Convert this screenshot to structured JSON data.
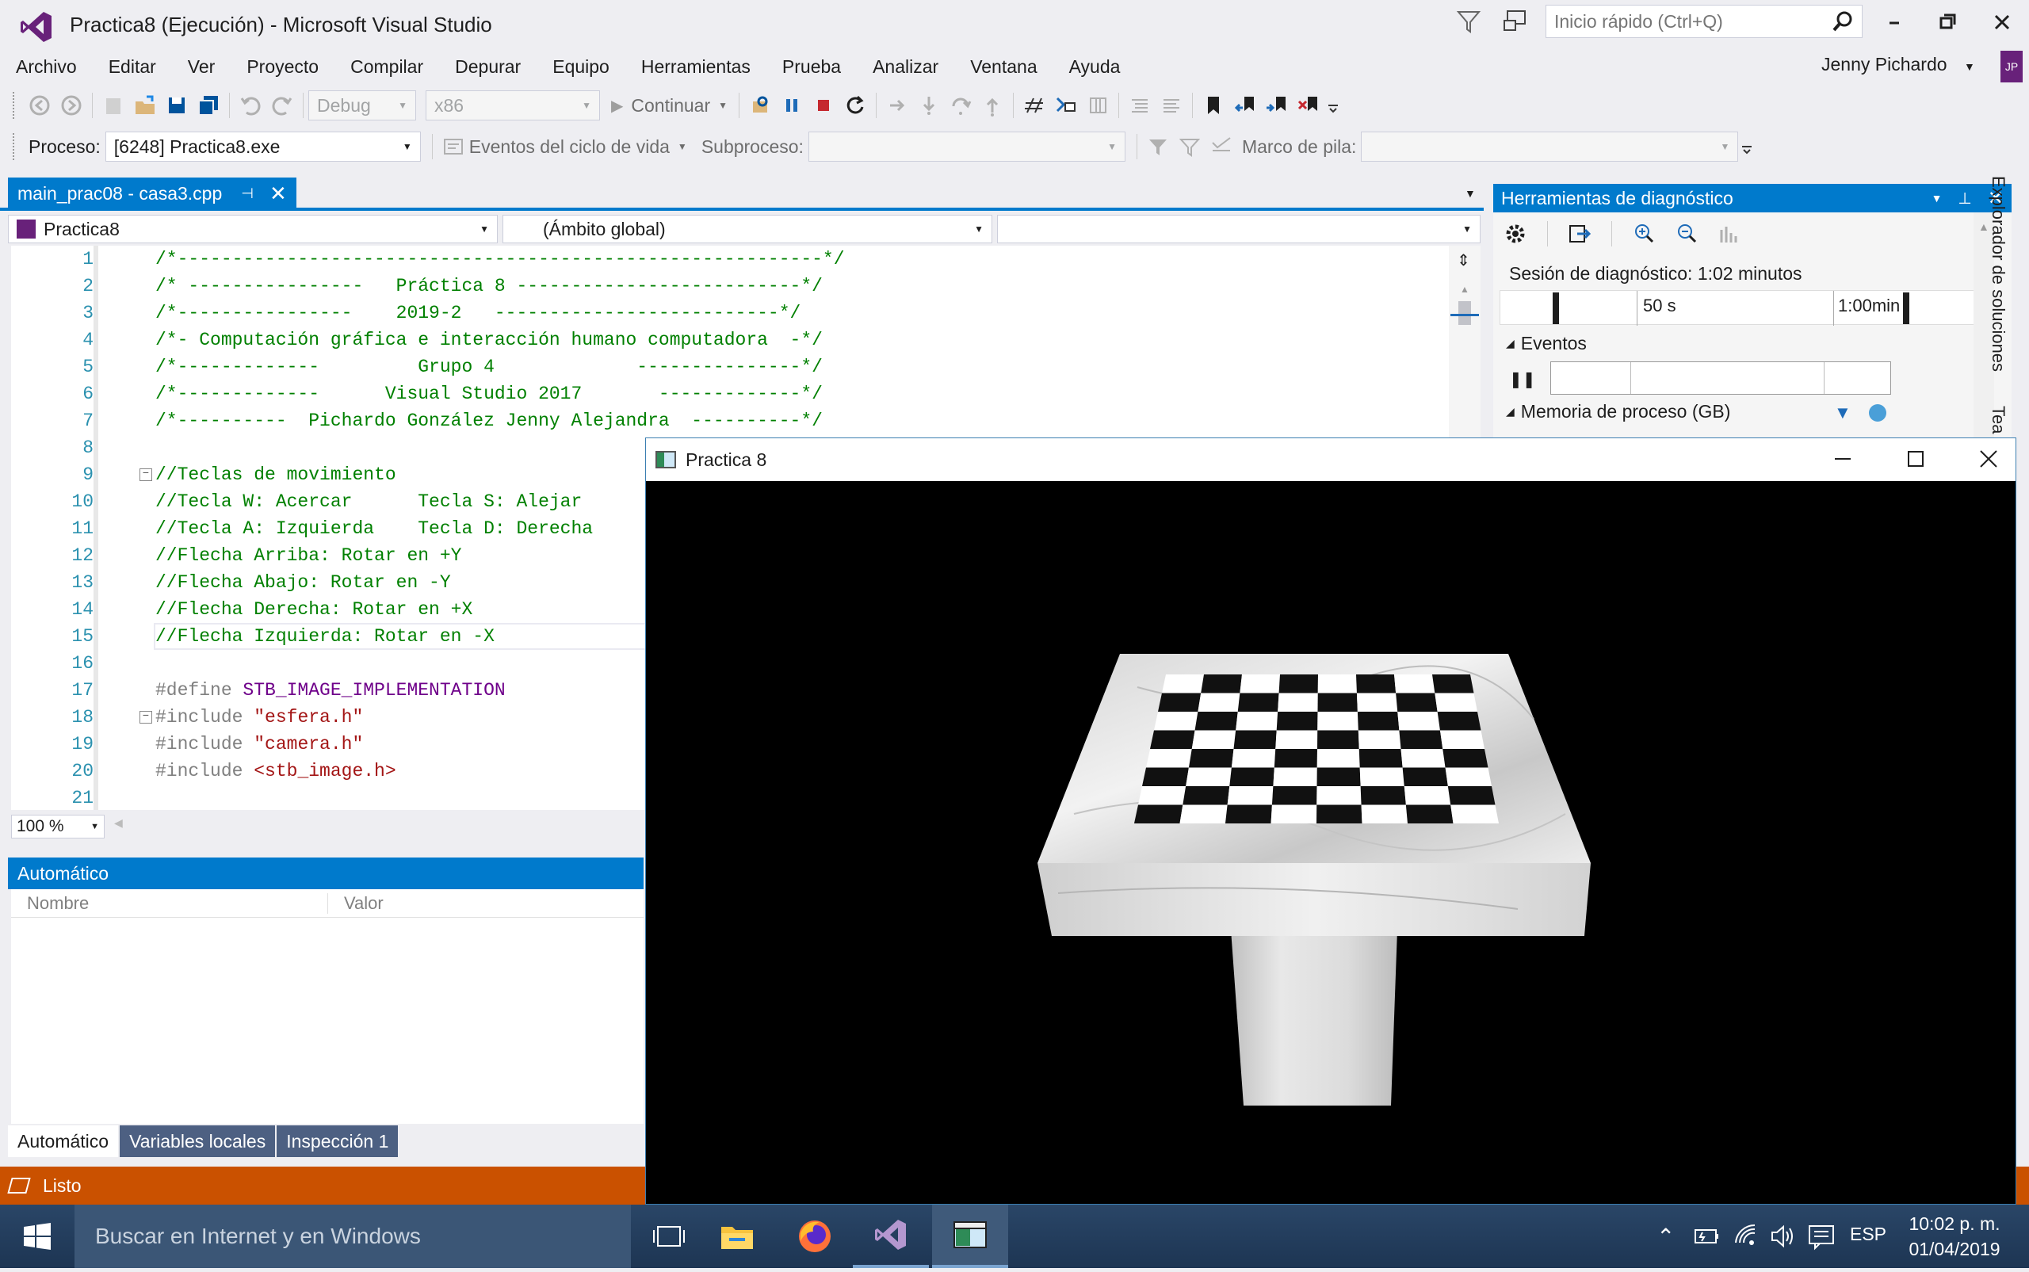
{
  "window": {
    "title": "Practica8 (Ejecución) - Microsoft Visual Studio",
    "quick_launch_placeholder": "Inicio rápido (Ctrl+Q)",
    "user": "Jenny Pichardo",
    "user_initials": "JP"
  },
  "menu": [
    "Archivo",
    "Editar",
    "Ver",
    "Proyecto",
    "Compilar",
    "Depurar",
    "Equipo",
    "Herramientas",
    "Prueba",
    "Analizar",
    "Ventana",
    "Ayuda"
  ],
  "toolbar": {
    "config": "Debug",
    "platform": "x86",
    "continue_label": "Continuar"
  },
  "debug_bar": {
    "process_label": "Proceso:",
    "process_value": "[6248] Practica8.exe",
    "lifecycle_label": "Eventos del ciclo de vida",
    "thread_label": "Subproceso:",
    "stack_label": "Marco de pila:"
  },
  "editor": {
    "tab_label": "main_prac08 - casa3.cpp",
    "project_combo": "Practica8",
    "scope_combo": "(Ámbito global)",
    "zoom": "100 %",
    "lines": [
      {
        "n": "1",
        "segments": [
          {
            "t": "/*-----------------------------------------------------------*/",
            "c": "cmt"
          }
        ]
      },
      {
        "n": "2",
        "segments": [
          {
            "t": "/* ----------------   Práctica 8 --------------------------*/",
            "c": "cmt"
          }
        ]
      },
      {
        "n": "3",
        "segments": [
          {
            "t": "/*----------------    2019-2   --------------------------*/",
            "c": "cmt"
          }
        ]
      },
      {
        "n": "4",
        "segments": [
          {
            "t": "/*- Computación gráfica e interacción humano computadora  -*/",
            "c": "cmt"
          }
        ]
      },
      {
        "n": "5",
        "segments": [
          {
            "t": "/*-------------         Grupo 4             ---------------*/",
            "c": "cmt"
          }
        ]
      },
      {
        "n": "6",
        "segments": [
          {
            "t": "/*-------------      Visual Studio 2017       -------------*/",
            "c": "cmt"
          }
        ]
      },
      {
        "n": "7",
        "segments": [
          {
            "t": "/*----------  Pichardo González Jenny Alejandra  ----------*/",
            "c": "cmt"
          }
        ]
      },
      {
        "n": "8",
        "segments": []
      },
      {
        "n": "9",
        "segments": [
          {
            "t": "//Teclas de movimiento",
            "c": "cmt"
          }
        ],
        "fold": true
      },
      {
        "n": "10",
        "segments": [
          {
            "t": "//Tecla W: Acercar      Tecla S: Alejar",
            "c": "cmt"
          }
        ]
      },
      {
        "n": "11",
        "segments": [
          {
            "t": "//Tecla A: Izquierda    Tecla D: Derecha",
            "c": "cmt"
          }
        ]
      },
      {
        "n": "12",
        "segments": [
          {
            "t": "//Flecha Arriba: Rotar en +Y",
            "c": "cmt"
          }
        ]
      },
      {
        "n": "13",
        "segments": [
          {
            "t": "//Flecha Abajo: Rotar en -Y",
            "c": "cmt"
          }
        ]
      },
      {
        "n": "14",
        "segments": [
          {
            "t": "//Flecha Derecha: Rotar en +X",
            "c": "cmt"
          }
        ]
      },
      {
        "n": "15",
        "segments": [
          {
            "t": "//Flecha Izquierda: Rotar en -X",
            "c": "cmt"
          }
        ]
      },
      {
        "n": "16",
        "segments": []
      },
      {
        "n": "17",
        "segments": [
          {
            "t": "#define ",
            "c": "prep"
          },
          {
            "t": "STB_IMAGE_IMPLEMENTATION",
            "c": "macro"
          }
        ]
      },
      {
        "n": "18",
        "segments": [
          {
            "t": "#include ",
            "c": "prep"
          },
          {
            "t": "\"esfera.h\"",
            "c": "str"
          }
        ],
        "fold": true
      },
      {
        "n": "19",
        "segments": [
          {
            "t": "#include ",
            "c": "prep"
          },
          {
            "t": "\"camera.h\"",
            "c": "str"
          }
        ]
      },
      {
        "n": "20",
        "segments": [
          {
            "t": "#include ",
            "c": "prep"
          },
          {
            "t": "<stb_image.h>",
            "c": "str"
          }
        ]
      },
      {
        "n": "21",
        "segments": []
      }
    ]
  },
  "diagnostics": {
    "title": "Herramientas de diagnóstico",
    "session": "Sesión de diagnóstico: 1:02 minutos",
    "tick1": "50 s",
    "tick2": "1:00min",
    "events": "Eventos",
    "memory": "Memoria de proceso (GB)"
  },
  "autos": {
    "title": "Automático",
    "col_name": "Nombre",
    "col_value": "Valor",
    "tabs": [
      "Automático",
      "Variables locales",
      "Inspección 1"
    ]
  },
  "side_tabs": {
    "solution": "Explorador de soluciones",
    "team": "Tea"
  },
  "status": {
    "text": "Listo"
  },
  "glwindow": {
    "title": "Practica 8"
  },
  "taskbar": {
    "search_placeholder": "Buscar en Internet y en Windows",
    "lang": "ESP",
    "time": "10:02 p. m.",
    "date": "01/04/2019"
  },
  "colors": {
    "accent": "#007acc",
    "status_bar": "#ca5100",
    "vs_purple": "#68217a"
  }
}
